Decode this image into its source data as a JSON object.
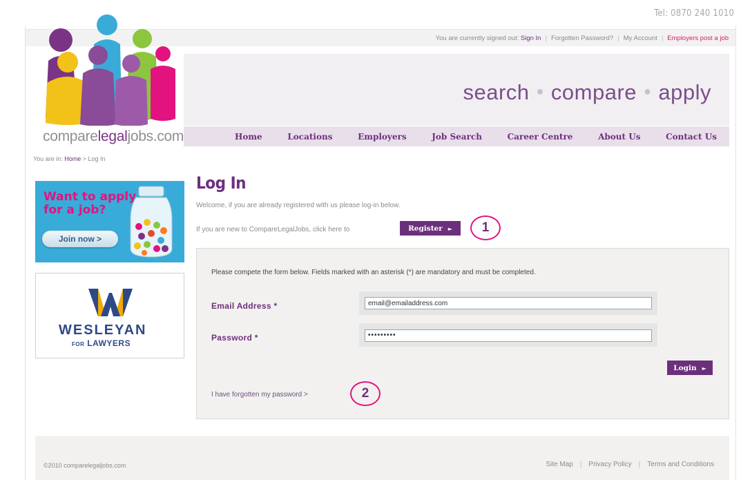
{
  "phone": "Tel: 0870 240 1010",
  "topbar": {
    "status_text": "You are currently signed out:",
    "sign_in": "Sign In",
    "forgotten_password": "Forgotten Password?",
    "my_account": "My Account",
    "employers_post": "Employers post a job"
  },
  "logo": {
    "text_compare": "compare",
    "text_legal": "legal",
    "text_jobs": "jobs.com"
  },
  "tagline": {
    "word1": "search",
    "word2": "compare",
    "word3": "apply",
    "dot": "●"
  },
  "nav": {
    "items": [
      "Home",
      "Locations",
      "Employers",
      "Job Search",
      "Career Centre",
      "About Us",
      "Contact Us"
    ]
  },
  "breadcrumb": {
    "prefix": "You are in:",
    "home": "Home",
    "separator": ">",
    "current": "Log In"
  },
  "ads": {
    "apply_title_line1": "Want to apply",
    "apply_title_line2": "for a job?",
    "join_button": "Join now >",
    "sponsor_name": "WESLEYAN",
    "sponsor_sub_small": "FOR",
    "sponsor_sub": "LAWYERS"
  },
  "login": {
    "title": "Log In",
    "welcome": "Welcome, if you are already registered with us please log-in below.",
    "new_user_text": "If you are new to CompareLegalJobs, click here to",
    "register_button": "Register",
    "instructions": "Please compete the form below. Fields marked with an asterisk (*) are mandatory and must be completed.",
    "email_label": "Email Address *",
    "email_value": "email@emailaddress.com",
    "password_label": "Password *",
    "password_value": "•••••••••",
    "login_button": "Login",
    "forgot_link": "I have forgotten my password >",
    "arrow": "►"
  },
  "annotations": {
    "marker1": "1",
    "marker2": "2"
  },
  "footer": {
    "copyright": "©2010 comparelegaljobs.com",
    "links": [
      "Site Map",
      "Privacy Policy",
      "Terms and Conditions"
    ]
  },
  "colors": {
    "brand_purple": "#6e2f7f",
    "brand_pink": "#e2137f",
    "nav_bg": "#e9dfea",
    "hero_bg": "#f2eff2"
  }
}
